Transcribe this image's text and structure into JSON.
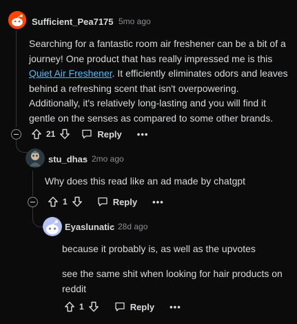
{
  "comments": [
    {
      "username": "Sufficient_Pea7175",
      "dot": "•",
      "time": "5mo ago",
      "body_part1": "Searching for a fantastic room air freshener can be a bit of a journey! One product that has really impressed me is this ",
      "body_link": "Quiet Air Freshener",
      "body_part2": ". It efficiently eliminates odors and leaves behind a refreshing scent that isn't overpowering. Additionally, it's relatively long-lasting and you will find it gentle on the senses as compared to some other brands.",
      "votes": "21",
      "reply_label": "Reply",
      "more_label": "•••"
    },
    {
      "username": "stu_dhas",
      "dot": "•",
      "time": "2mo ago",
      "body": "Why does this read like an ad made by chatgpt",
      "votes": "1",
      "reply_label": "Reply",
      "more_label": "•••"
    },
    {
      "username": "Eyaslunatic",
      "dot": "•",
      "time": "28d ago",
      "body_para1": "because it probably is, as well as the upvotes",
      "body_para2": "see the same shit when looking for hair products on reddit",
      "votes": "1",
      "reply_label": "Reply",
      "more_label": "•••"
    }
  ],
  "colors": {
    "background": "#0b0b0b",
    "text": "#d7dadc",
    "meta": "#8b8f93",
    "link": "#4fbcff",
    "thread_line": "#343536"
  },
  "icons": [
    "collapse-icon",
    "upvote-icon",
    "downvote-icon",
    "reply-icon",
    "more-icon",
    "avatar"
  ]
}
